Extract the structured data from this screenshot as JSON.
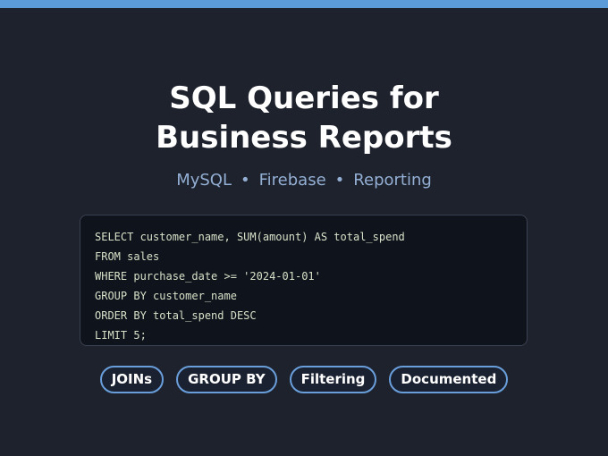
{
  "header": {
    "title_line1": "SQL Queries for",
    "title_line2": "Business Reports"
  },
  "subtitle": {
    "items": [
      "MySQL",
      "Firebase",
      "Reporting"
    ],
    "separator": "•"
  },
  "code": {
    "lines": [
      "SELECT customer_name, SUM(amount) AS total_spend",
      "FROM sales",
      "WHERE purchase_date >= '2024-01-01'",
      "GROUP BY customer_name",
      "ORDER BY total_spend DESC",
      "LIMIT 5;"
    ]
  },
  "tags": [
    "JOINs",
    "GROUP BY",
    "Filtering",
    "Documented"
  ],
  "colors": {
    "accent_bar": "#5b9bd8",
    "background": "#1d222c",
    "subtitle": "#94afd4",
    "tag_border": "#6a9edb"
  }
}
